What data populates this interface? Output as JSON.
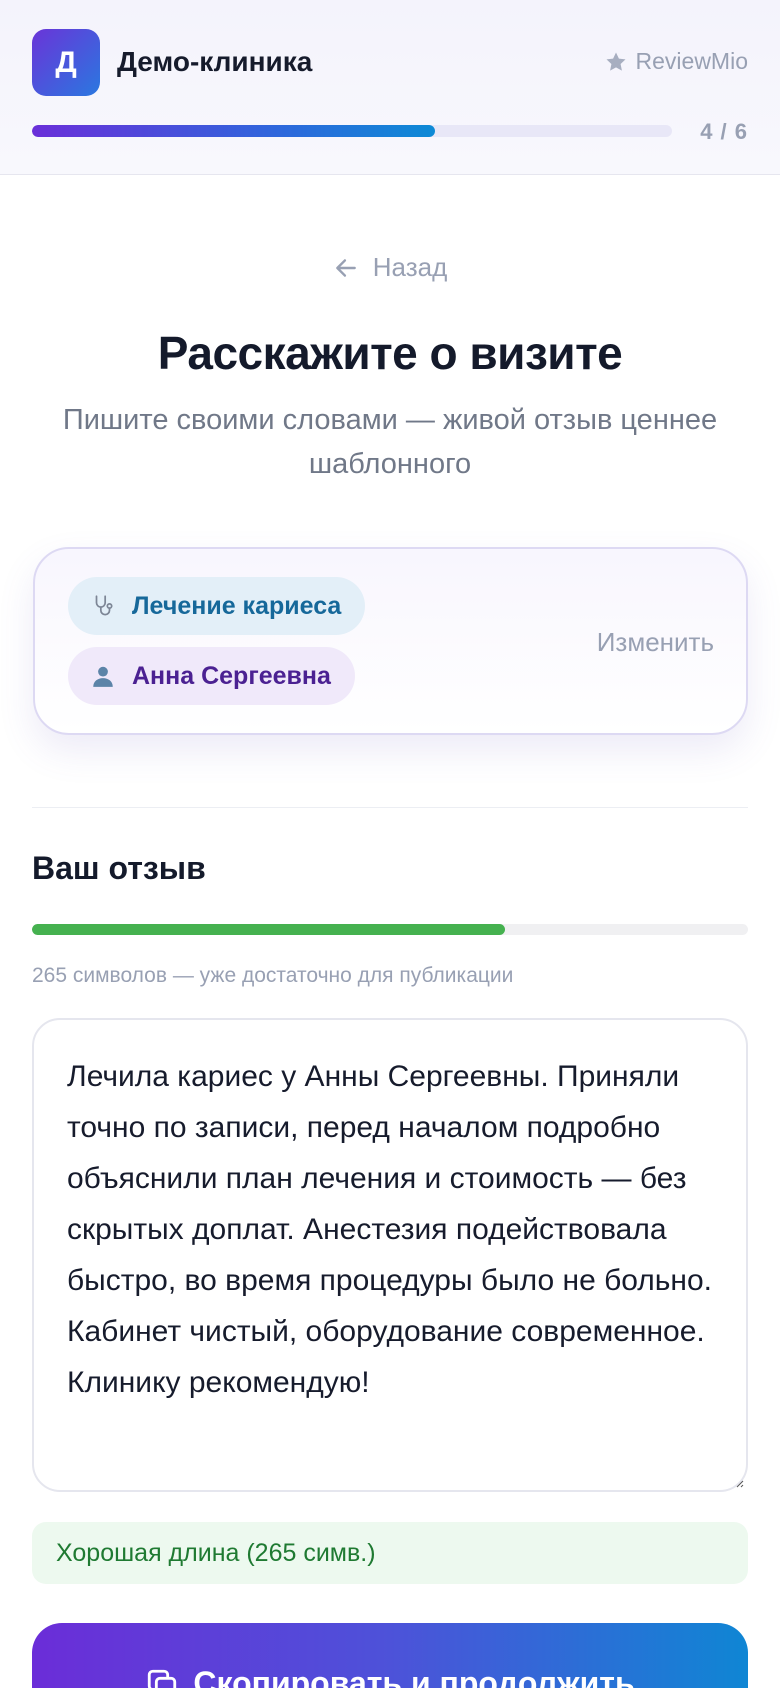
{
  "header": {
    "logo_letter": "Д",
    "clinic_name": "Демо-клиника",
    "brand_name": "ReviewMio",
    "step_label": "4 / 6",
    "progress_fraction": 0.63
  },
  "nav": {
    "back_label": "Назад"
  },
  "intro": {
    "title": "Расскажите о визите",
    "subtitle": "Пишите своими словами — живой отзыв ценнее шаблонного"
  },
  "selection": {
    "service_label": "Лечение кариеса",
    "service_icon": "stethoscope-icon",
    "doctor_label": "Анна Сергеевна",
    "doctor_icon": "person-icon",
    "change_label": "Изменить"
  },
  "review": {
    "heading": "Ваш отзыв",
    "quality_fraction": 0.66,
    "quality_color": "#45b14f",
    "char_hint": "265 символов — уже достаточно для публикации",
    "text": "Лечила кариес у Анны Сергеевны. Приняли точно по записи, перед началом подробно объяснили план лечения и стоимость — без скрытых доплат. Анестезия подействовала быстро, во время процедуры было не больно. Кабинет чистый, оборудование современное. Клинику рекомендую!",
    "length_note": "Хорошая длина (265 симв.)"
  },
  "cta": {
    "label": "Скопировать и продолжить",
    "icon": "copy-icon"
  },
  "colors": {
    "accent_start": "#6a2fd9",
    "accent_end": "#0d8ad6",
    "muted_text": "#98a0b3"
  }
}
